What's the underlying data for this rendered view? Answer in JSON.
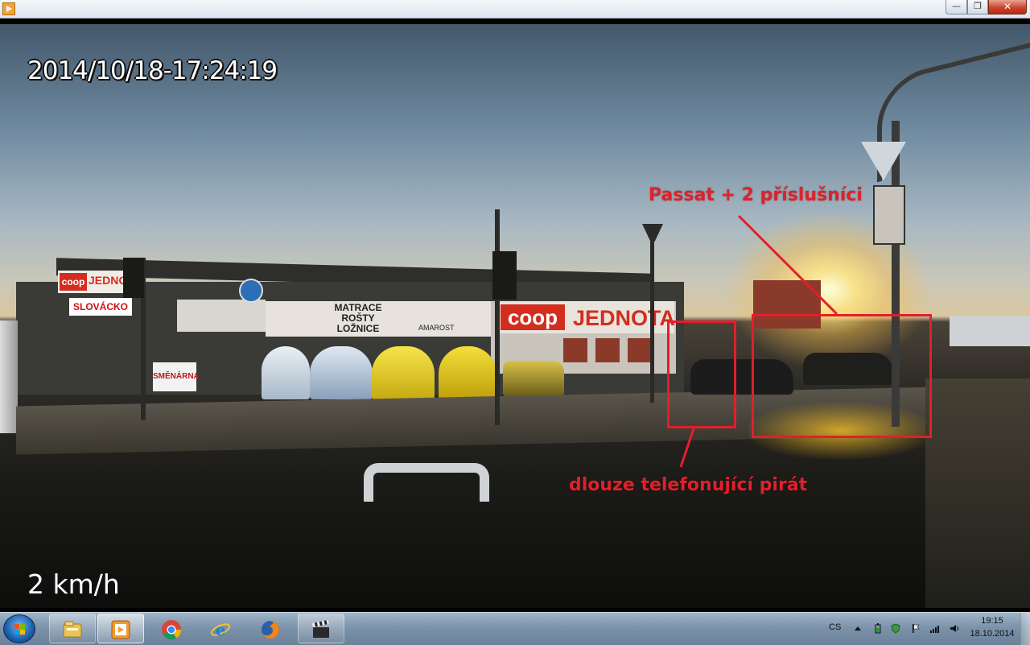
{
  "window": {
    "minimize_glyph": "—",
    "maximize_glyph": "❐",
    "close_glyph": "✕"
  },
  "video": {
    "timestamp": "2014/10/18-17:24:19",
    "speed": "2 km/h",
    "signs": {
      "coop_left_logo": "coop",
      "coop_left_name": "JEDNO",
      "slovacko": "SLOVÁCKO",
      "mattress": "MATRACE\nROŠTY\nLOŽNICE",
      "amarost": "AMAROST",
      "coop_big_logo": "coop",
      "coop_big_name": "JEDNOTA",
      "smenarna": "SMĚNÁRNA"
    },
    "annotations": {
      "passat_label": "Passat + 2 příslušníci",
      "pirate_label": "dlouze telefonující pirát",
      "color": "#e0202a"
    }
  },
  "taskbar": {
    "start_icon": "windows-logo",
    "pinned": [
      {
        "name": "windows-explorer-icon"
      },
      {
        "name": "media-player-icon",
        "active": true
      },
      {
        "name": "chrome-icon"
      },
      {
        "name": "internet-explorer-icon"
      },
      {
        "name": "firefox-icon"
      },
      {
        "name": "video-clapper-icon"
      }
    ],
    "tray": {
      "language": "CS",
      "time": "19:15",
      "date": "18.10.2014"
    }
  }
}
